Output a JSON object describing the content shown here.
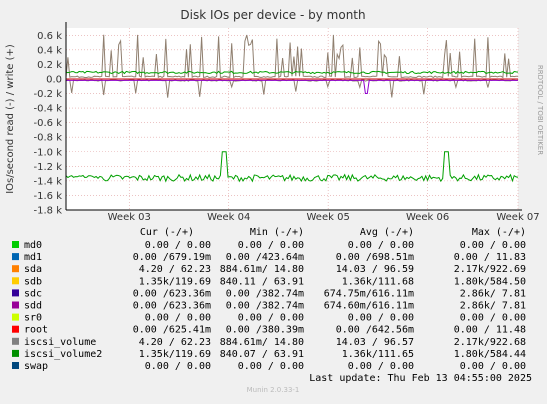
{
  "chart_data": {
    "type": "line",
    "title": "Disk IOs per device - by month",
    "ylabel": "IOs/second read (-) / write (+)",
    "side_label": "RRDTOOL / TOBI OETIKER",
    "ylim": [
      -1.8,
      0.7
    ],
    "y_ticks": [
      "0.6 k",
      "0.4 k",
      "0.2 k",
      "0.0",
      "-0.2 k",
      "-0.4 k",
      "-0.6 k",
      "-0.8 k",
      "-1.0 k",
      "-1.2 k",
      "-1.4 k",
      "-1.6 k",
      "-1.8 k"
    ],
    "y_tick_values": [
      0.6,
      0.4,
      0.2,
      0.0,
      -0.2,
      -0.4,
      -0.6,
      -0.8,
      -1.0,
      -1.2,
      -1.4,
      -1.6,
      -1.8
    ],
    "x_ticks": [
      "Week 03",
      "Week 04",
      "Week 05",
      "Week 06",
      "Week 07"
    ],
    "x_tick_values": [
      0.14,
      0.36,
      0.58,
      0.8,
      1.0
    ],
    "series": [
      {
        "name": "iscsi_volume2",
        "color": "#00A000",
        "read_baseline": -1.36,
        "write_baseline": 0.09
      },
      {
        "name": "iscsi_volume",
        "color": "#8F7F6F",
        "read_baseline": -0.01,
        "write_baseline": 0.02
      },
      {
        "name": "sdd",
        "color": "#8F00CC",
        "read_baseline": -0.02,
        "write_baseline": 0.0
      },
      {
        "name": "root",
        "color": "#CC0000",
        "read_baseline": -0.02,
        "write_baseline": 0.0
      }
    ]
  },
  "legend": {
    "headers": {
      "cur": "Cur (-/+)",
      "min": "Min (-/+)",
      "avg": "Avg (-/+)",
      "max": "Max (-/+)"
    },
    "rows": [
      {
        "name": "md0",
        "color": "#00CC00",
        "cur": "0.00 /  0.00",
        "min": "0.00 /  0.00",
        "avg": "0.00 /  0.00",
        "max": "0.00 /  0.00"
      },
      {
        "name": "md1",
        "color": "#0066B3",
        "cur": "0.00 /679.19m",
        "min": "0.00 /423.64m",
        "avg": "0.00 /698.51m",
        "max": "0.00 / 11.83"
      },
      {
        "name": "sda",
        "color": "#FF8000",
        "cur": "4.20 / 62.23",
        "min": "884.61m/ 14.80",
        "avg": "14.03 / 96.59",
        "max": "2.17k/922.69"
      },
      {
        "name": "sdb",
        "color": "#FFCC00",
        "cur": "1.35k/119.69",
        "min": "840.11 / 63.91",
        "avg": "1.36k/111.68",
        "max": "1.80k/584.50"
      },
      {
        "name": "sdc",
        "color": "#330099",
        "cur": "0.00 /623.36m",
        "min": "0.00 /382.74m",
        "avg": "674.75m/616.11m",
        "max": "2.86k/  7.81"
      },
      {
        "name": "sdd",
        "color": "#990099",
        "cur": "0.00 /623.36m",
        "min": "0.00 /382.74m",
        "avg": "674.60m/616.11m",
        "max": "2.86k/  7.81"
      },
      {
        "name": "sr0",
        "color": "#CCFF00",
        "cur": "0.00 /  0.00",
        "min": "0.00 /  0.00",
        "avg": "0.00 /  0.00",
        "max": "0.00 /  0.00"
      },
      {
        "name": "root",
        "color": "#FF0000",
        "cur": "0.00 /625.41m",
        "min": "0.00 /380.39m",
        "avg": "0.00 /642.56m",
        "max": "0.00 / 11.48"
      },
      {
        "name": "iscsi_volume",
        "color": "#808080",
        "cur": "4.20 / 62.23",
        "min": "884.61m/ 14.80",
        "avg": "14.03 / 96.57",
        "max": "2.17k/922.68"
      },
      {
        "name": "iscsi_volume2",
        "color": "#008F00",
        "cur": "1.35k/119.69",
        "min": "840.07 / 63.91",
        "avg": "1.36k/111.65",
        "max": "1.80k/584.44"
      },
      {
        "name": "swap",
        "color": "#00487D",
        "cur": "0.00 /  0.00",
        "min": "0.00 /  0.00",
        "avg": "0.00 /  0.00",
        "max": "0.00 /  0.00"
      }
    ]
  },
  "footer": {
    "last_update": "Last update: Thu Feb 13 04:55:00 2025",
    "version": "Munin 2.0.33-1"
  }
}
